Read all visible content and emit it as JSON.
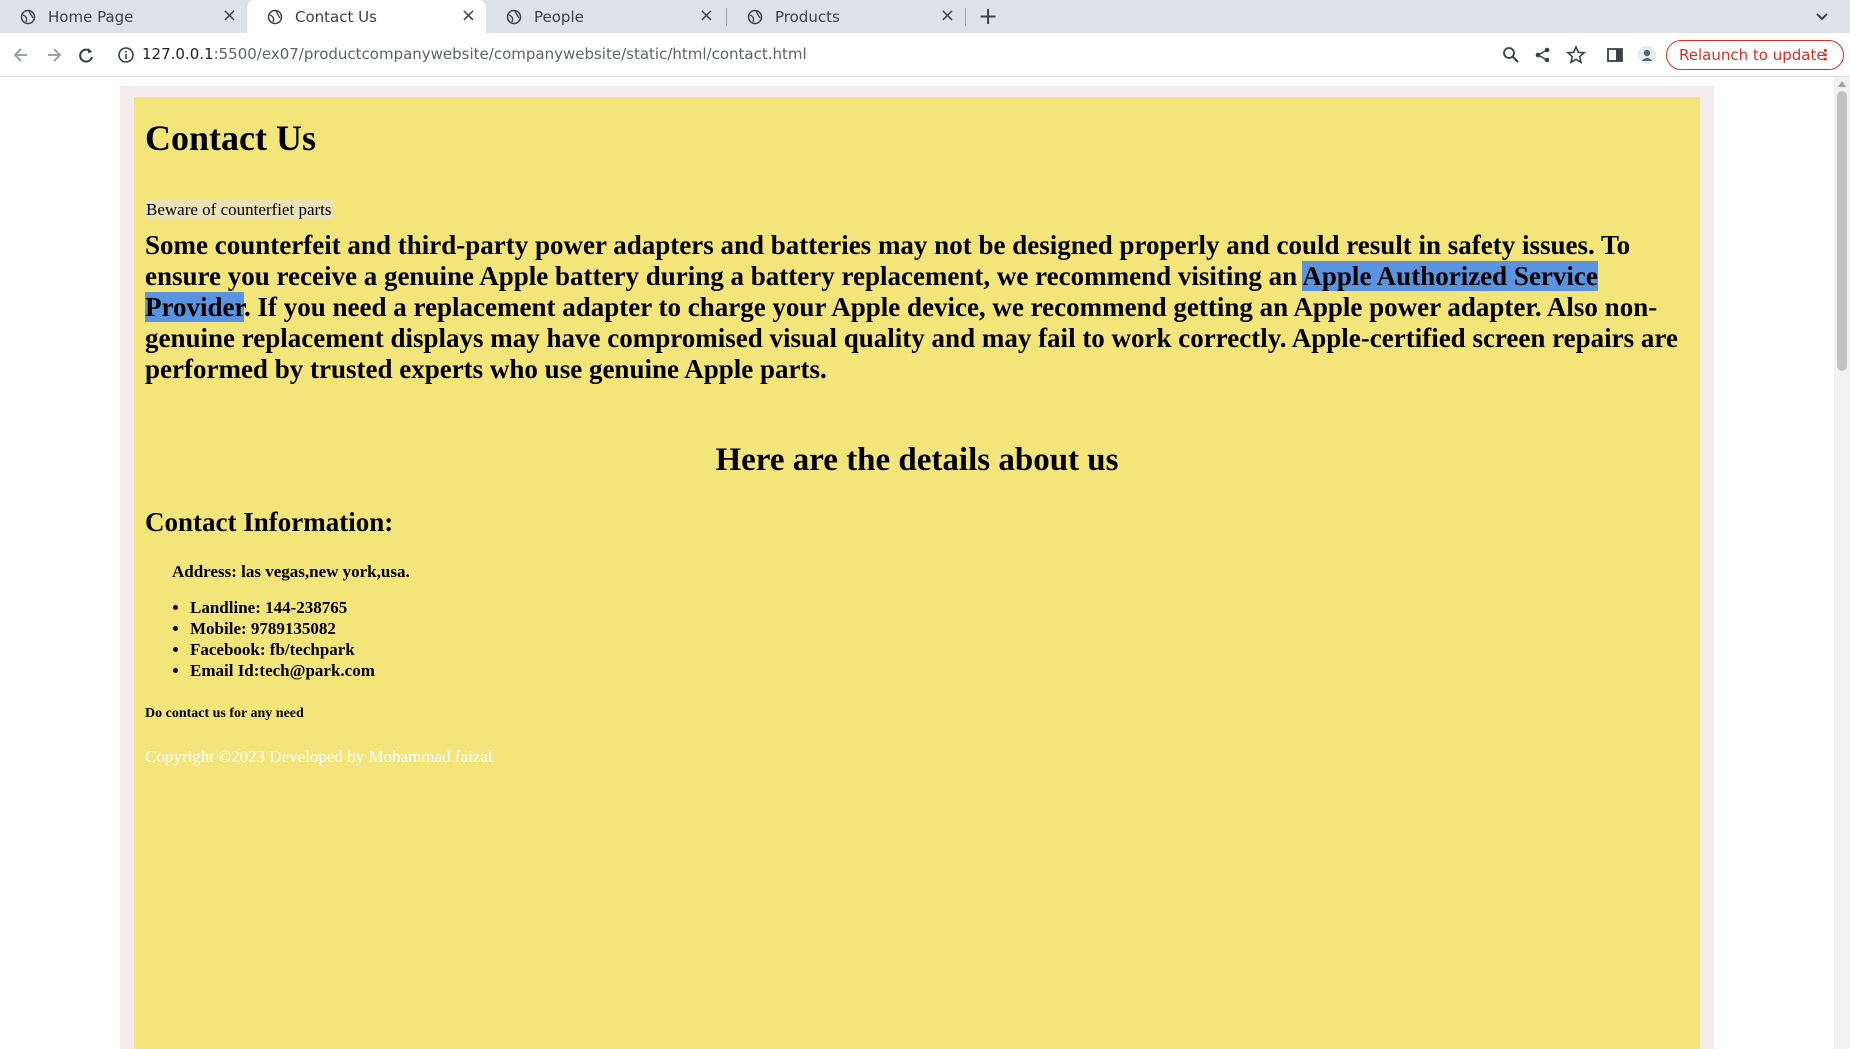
{
  "browser": {
    "tabs": [
      {
        "label": "Home Page",
        "active": false
      },
      {
        "label": "Contact Us",
        "active": true
      },
      {
        "label": "People",
        "active": false
      },
      {
        "label": "Products",
        "active": false
      }
    ],
    "url_host": "127.0.0.1",
    "url_rest": ":5500/ex07/productcompanywebsite/companywebsite/static/html/contact.html",
    "relaunch_label": "Relaunch to update",
    "colors": {
      "relaunch": "#d93025",
      "tabstrip": "#dee1e6"
    }
  },
  "page": {
    "title": "Contact Us",
    "warning": "Beware of counterfiet parts",
    "paragraph_before": "Some counterfeit and third-party power adapters and batteries may not be designed properly and could result in safety issues. To ensure you receive a genuine Apple battery during a battery replacement, we recommend visiting an ",
    "paragraph_highlight": "Apple Authorized Service Provider",
    "paragraph_after": ". If you need a replacement adapter to charge your Apple device, we recommend getting an Apple power adapter. Also non-genuine replacement displays may have compromised visual quality and may fail to work correctly. Apple-certified screen repairs are performed by trusted experts who use genuine Apple parts.",
    "details_heading": "Here are the details about us",
    "contact_heading": "Contact Information:",
    "address": "Address: las vegas,new york,usa.",
    "contacts": [
      "Landline: 144-238765",
      "Mobile: 9789135082",
      "Facebook: fb/techpark",
      "Email Id:tech@park.com"
    ],
    "need_text": "Do contact us for any need",
    "copyright": "Copyright ©2023 Developed by Mohammad faizal",
    "colors": {
      "background": "#f3e57a",
      "highlight": "#5a93e0",
      "footer_text": "#ffffff"
    }
  }
}
